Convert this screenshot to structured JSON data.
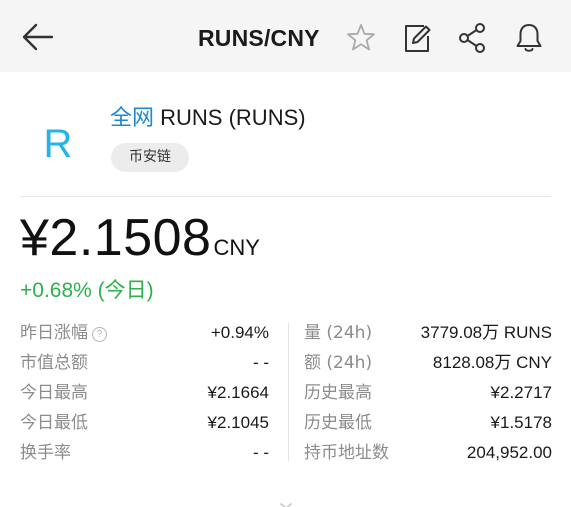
{
  "header": {
    "title": "RUNS/CNY",
    "icons": [
      "back-arrow-icon",
      "star-icon",
      "edit-icon",
      "share-icon",
      "bell-icon"
    ]
  },
  "token": {
    "logo_letter": "R",
    "network": "全网",
    "name": "RUNS (RUNS)",
    "chain": "币安链",
    "accent_color": "#26b3e8"
  },
  "price": {
    "value": "¥2.1508",
    "unit": "CNY",
    "change": "+0.68% (今日)",
    "change_color": "#2bb24c"
  },
  "stats": {
    "left": [
      {
        "label": "昨日涨幅",
        "value": "+0.94%"
      },
      {
        "label": "市值总额",
        "value": "- -"
      },
      {
        "label": "今日最高",
        "value": "¥2.1664"
      },
      {
        "label": "今日最低",
        "value": "¥2.1045"
      },
      {
        "label": "换手率",
        "value": "- -"
      }
    ],
    "right": [
      {
        "label": "量 (24h)",
        "value": "3779.08万 RUNS"
      },
      {
        "label": "额 (24h)",
        "value": "8128.08万 CNY"
      },
      {
        "label": "历史最高",
        "value": "¥2.2717"
      },
      {
        "label": "历史最低",
        "value": "¥1.5178"
      },
      {
        "label": "持币地址数",
        "value": "204,952.00"
      }
    ]
  }
}
